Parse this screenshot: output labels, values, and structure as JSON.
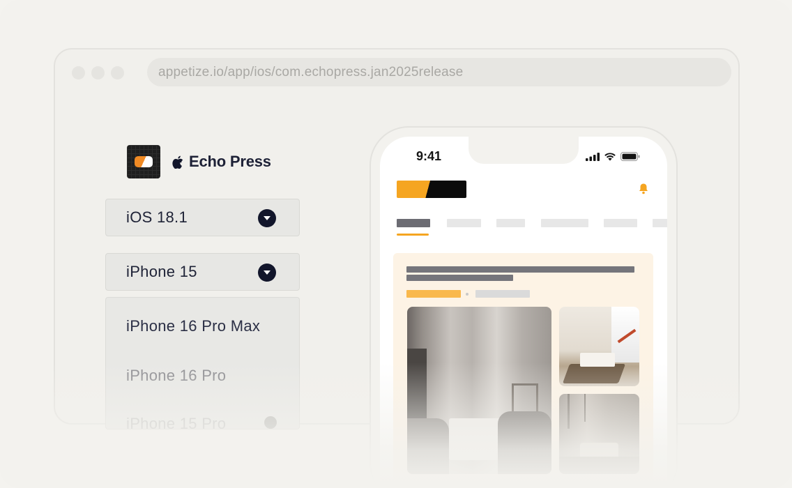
{
  "browser": {
    "url": "appetize.io/app/ios/com.echopress.jan2025release"
  },
  "app": {
    "name": "Echo Press",
    "logo_icon": "app-logo-icon",
    "platform_icon": "apple-icon"
  },
  "selectors": {
    "os_version": "iOS 18.1",
    "device": "iPhone 15"
  },
  "device_options": [
    "iPhone 16 Pro Max",
    "iPhone 16 Pro",
    "iPhone 15 Pro"
  ],
  "phone": {
    "time": "9:41",
    "status_icons": [
      "signal-icon",
      "wifi-icon",
      "battery-icon"
    ]
  },
  "colors": {
    "accent": "#f5a521",
    "brand_dark": "#0b0b0b",
    "text_dark": "#1e2236"
  }
}
